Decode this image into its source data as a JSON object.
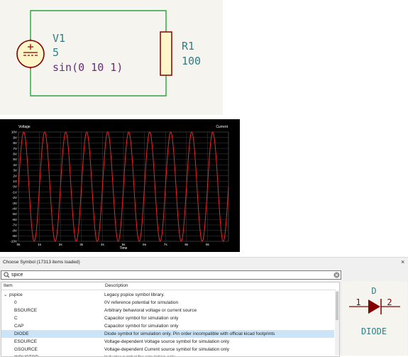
{
  "schematic": {
    "source_ref": "V1",
    "source_value": "5",
    "source_expr": "sin(0 10 1)",
    "resistor_ref": "R1",
    "resistor_value": "100",
    "colors": {
      "wire": "#2ea043",
      "symbol": "#840000",
      "text": "#2f7f82",
      "expr": "#6b2b7c",
      "background": "#f5f4ef"
    }
  },
  "plot": {
    "left_title": "Voltage",
    "right_title": "Current",
    "x_axis_label": "Time",
    "colors": {
      "trace": "#e8262a",
      "grid": "#3a3a3a",
      "background": "#000000",
      "text": "#ffffff"
    }
  },
  "chart_data": {
    "type": "line",
    "title": "",
    "xlabel": "Time",
    "ylabel": "Voltage",
    "y_tick_labels": [
      "10V",
      "9V",
      "8V",
      "7V",
      "6V",
      "5V",
      "4V",
      "3V",
      "2V",
      "1V",
      "0V",
      "-1V",
      "-2V",
      "-3V",
      "-4V",
      "-5V",
      "-6V",
      "-7V",
      "-8V",
      "-9V",
      "-10V"
    ],
    "x_tick_labels": [
      "0s",
      "1s",
      "2s",
      "3s",
      "4s",
      "5s",
      "6s",
      "7s",
      "8s",
      "9s"
    ],
    "xlim": [
      0,
      10
    ],
    "ylim": [
      -10,
      10
    ],
    "grid": true,
    "series": [
      {
        "name": "",
        "function": "10*sin(2*pi*1*t)",
        "amplitude": 10,
        "frequency": 1,
        "offset": 0
      }
    ]
  },
  "dialog": {
    "title": "Choose Symbol (17313 items loaded)",
    "close_glyph": "×",
    "search": {
      "value": "spice",
      "placeholder": ""
    },
    "columns": {
      "item": "Item",
      "description": "Description"
    },
    "rows": [
      {
        "item": "pspice",
        "desc": "Legacy pspice symbol library.",
        "expander": "⌄",
        "selected": false,
        "child": false
      },
      {
        "item": "0",
        "desc": "0V reference potential for simulation",
        "expander": "",
        "selected": false,
        "child": true
      },
      {
        "item": "BSOURCE",
        "desc": "Arbitrary behavioral voltage or current source",
        "expander": "",
        "selected": false,
        "child": true
      },
      {
        "item": "C",
        "desc": "Capacitor symbol for simulation only",
        "expander": "",
        "selected": false,
        "child": true
      },
      {
        "item": "CAP",
        "desc": "Capacitor symbol for simulation only",
        "expander": "",
        "selected": false,
        "child": true
      },
      {
        "item": "DIODE",
        "desc": "Diode symbol for simulation only. Pin order incompatible with official kicad footprints",
        "expander": "",
        "selected": true,
        "child": true
      },
      {
        "item": "ESOURCE",
        "desc": "Voltage-dependent Voltage source symbol for simulation only",
        "expander": "",
        "selected": false,
        "child": true
      },
      {
        "item": "GSOURCE",
        "desc": "Voltage-dependent Current source symbol for simulation only",
        "expander": "",
        "selected": false,
        "child": true
      },
      {
        "item": "INDUCTOR",
        "desc": "Inductor symbol for simulation only",
        "expander": "",
        "selected": false,
        "child": true
      }
    ],
    "selected_color": "#cce4f7",
    "preview": {
      "ref": "D",
      "value": "DIODE",
      "pin1": "1",
      "pin2": "2",
      "symbol_color": "#840000",
      "text_color": "#2f7f82"
    }
  }
}
